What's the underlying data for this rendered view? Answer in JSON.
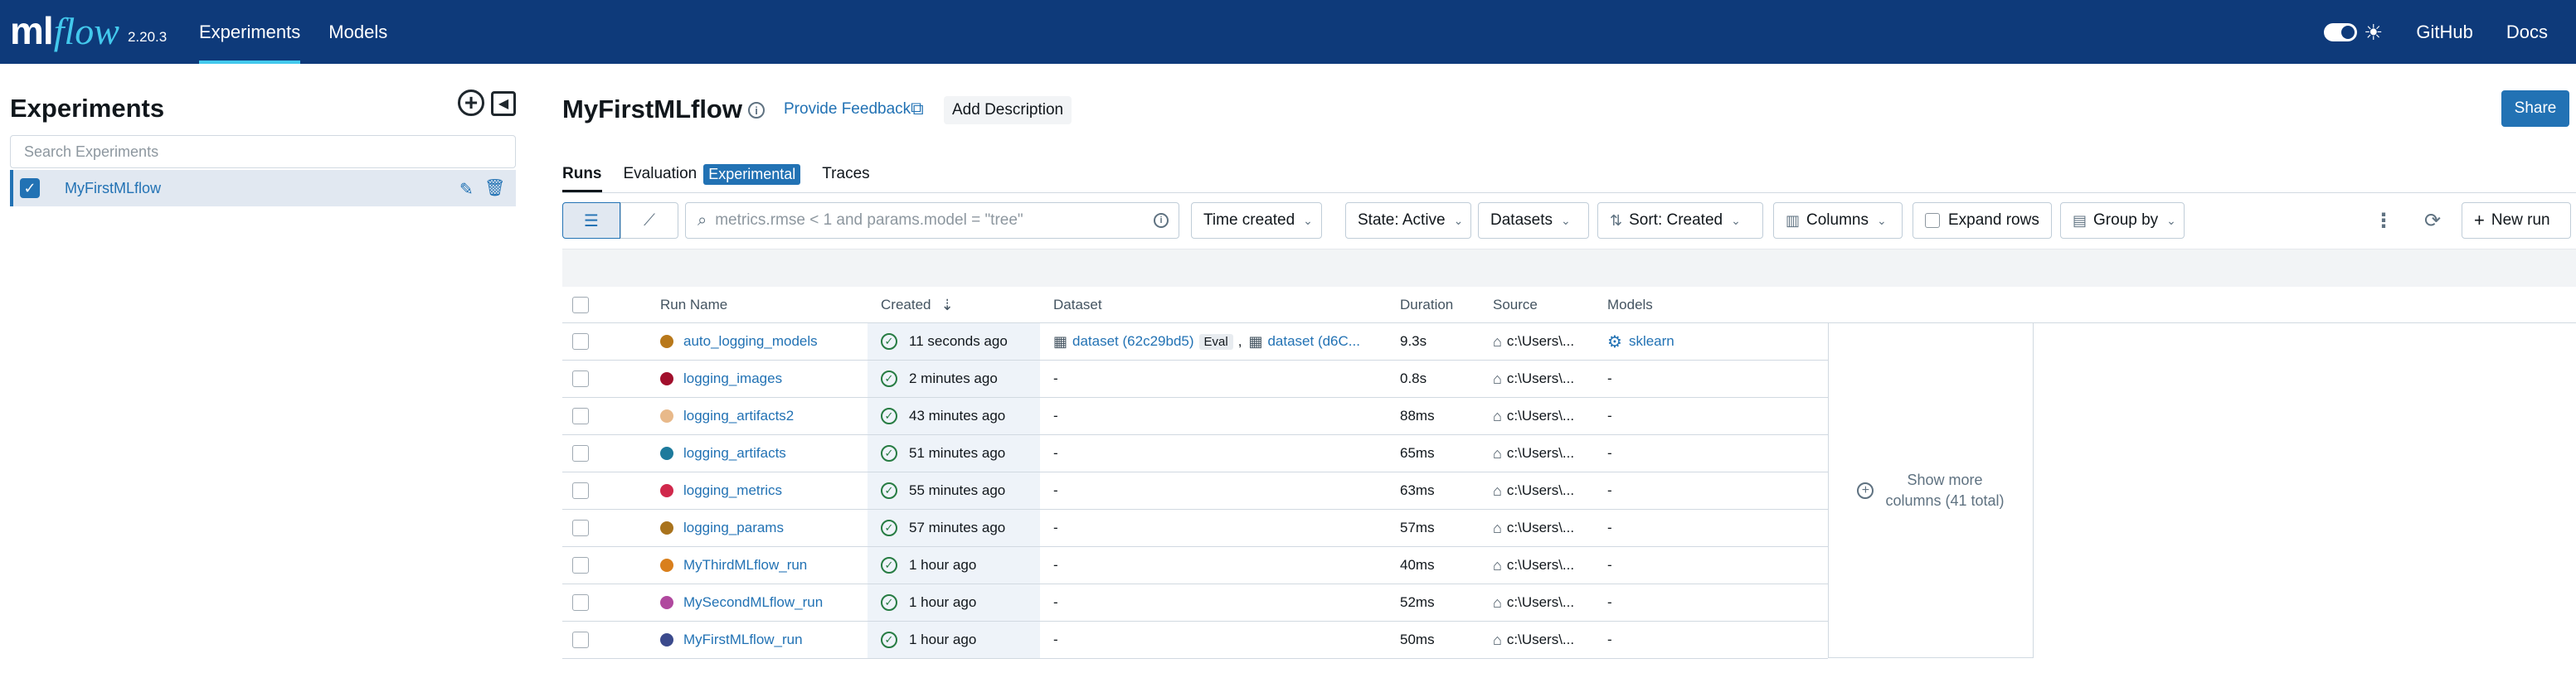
{
  "topbar": {
    "logo_ml": "ml",
    "logo_flow": "flow",
    "version": "2.20.3",
    "nav": [
      "Experiments",
      "Models"
    ],
    "active_nav": "Experiments",
    "links": [
      "GitHub",
      "Docs"
    ]
  },
  "sidebar": {
    "title": "Experiments",
    "search_placeholder": "Search Experiments",
    "items": [
      {
        "label": "MyFirstMLflow",
        "selected": true
      }
    ]
  },
  "header": {
    "title": "MyFirstMLflow",
    "feedback": "Provide Feedback",
    "add_description": "Add Description",
    "share": "Share"
  },
  "tabs": {
    "runs": "Runs",
    "evaluation": "Evaluation",
    "evaluation_tag": "Experimental",
    "traces": "Traces"
  },
  "toolbar": {
    "search_placeholder": "metrics.rmse < 1 and params.model = \"tree\"",
    "time_created": "Time created",
    "state": "State: Active",
    "datasets": "Datasets",
    "sort": "Sort: Created",
    "columns": "Columns",
    "expand_rows": "Expand rows",
    "group_by": "Group by",
    "new_run": "New run"
  },
  "table": {
    "headers": {
      "run_name": "Run Name",
      "created": "Created",
      "dataset": "Dataset",
      "duration": "Duration",
      "source": "Source",
      "models": "Models"
    },
    "rows": [
      {
        "name": "auto_logging_models",
        "color": "#b8781a",
        "created": "11 seconds ago",
        "dataset1": "dataset (62c29bd5)",
        "eval": "Eval",
        "dataset2": "dataset (d6C...",
        "duration": "9.3s",
        "source": "c:\\Users\\...",
        "model": "sklearn"
      },
      {
        "name": "logging_images",
        "color": "#a10f2c",
        "created": "2 minutes ago",
        "dataset": "-",
        "duration": "0.8s",
        "source": "c:\\Users\\...",
        "model": "-"
      },
      {
        "name": "logging_artifacts2",
        "color": "#e8b98a",
        "created": "43 minutes ago",
        "dataset": "-",
        "duration": "88ms",
        "source": "c:\\Users\\...",
        "model": "-"
      },
      {
        "name": "logging_artifacts",
        "color": "#1d7a9c",
        "created": "51 minutes ago",
        "dataset": "-",
        "duration": "65ms",
        "source": "c:\\Users\\...",
        "model": "-"
      },
      {
        "name": "logging_metrics",
        "color": "#d0284b",
        "created": "55 minutes ago",
        "dataset": "-",
        "duration": "63ms",
        "source": "c:\\Users\\...",
        "model": "-"
      },
      {
        "name": "logging_params",
        "color": "#a9731d",
        "created": "57 minutes ago",
        "dataset": "-",
        "duration": "57ms",
        "source": "c:\\Users\\...",
        "model": "-"
      },
      {
        "name": "MyThirdMLflow_run",
        "color": "#d97f1c",
        "created": "1 hour ago",
        "dataset": "-",
        "duration": "40ms",
        "source": "c:\\Users\\...",
        "model": "-"
      },
      {
        "name": "MySecondMLflow_run",
        "color": "#b0489e",
        "created": "1 hour ago",
        "dataset": "-",
        "duration": "52ms",
        "source": "c:\\Users\\...",
        "model": "-"
      },
      {
        "name": "MyFirstMLflow_run",
        "color": "#3b4a8c",
        "created": "1 hour ago",
        "dataset": "-",
        "duration": "50ms",
        "source": "c:\\Users\\...",
        "model": "-"
      }
    ],
    "show_more_line1": "Show more",
    "show_more_line2": "columns (41 total)"
  }
}
